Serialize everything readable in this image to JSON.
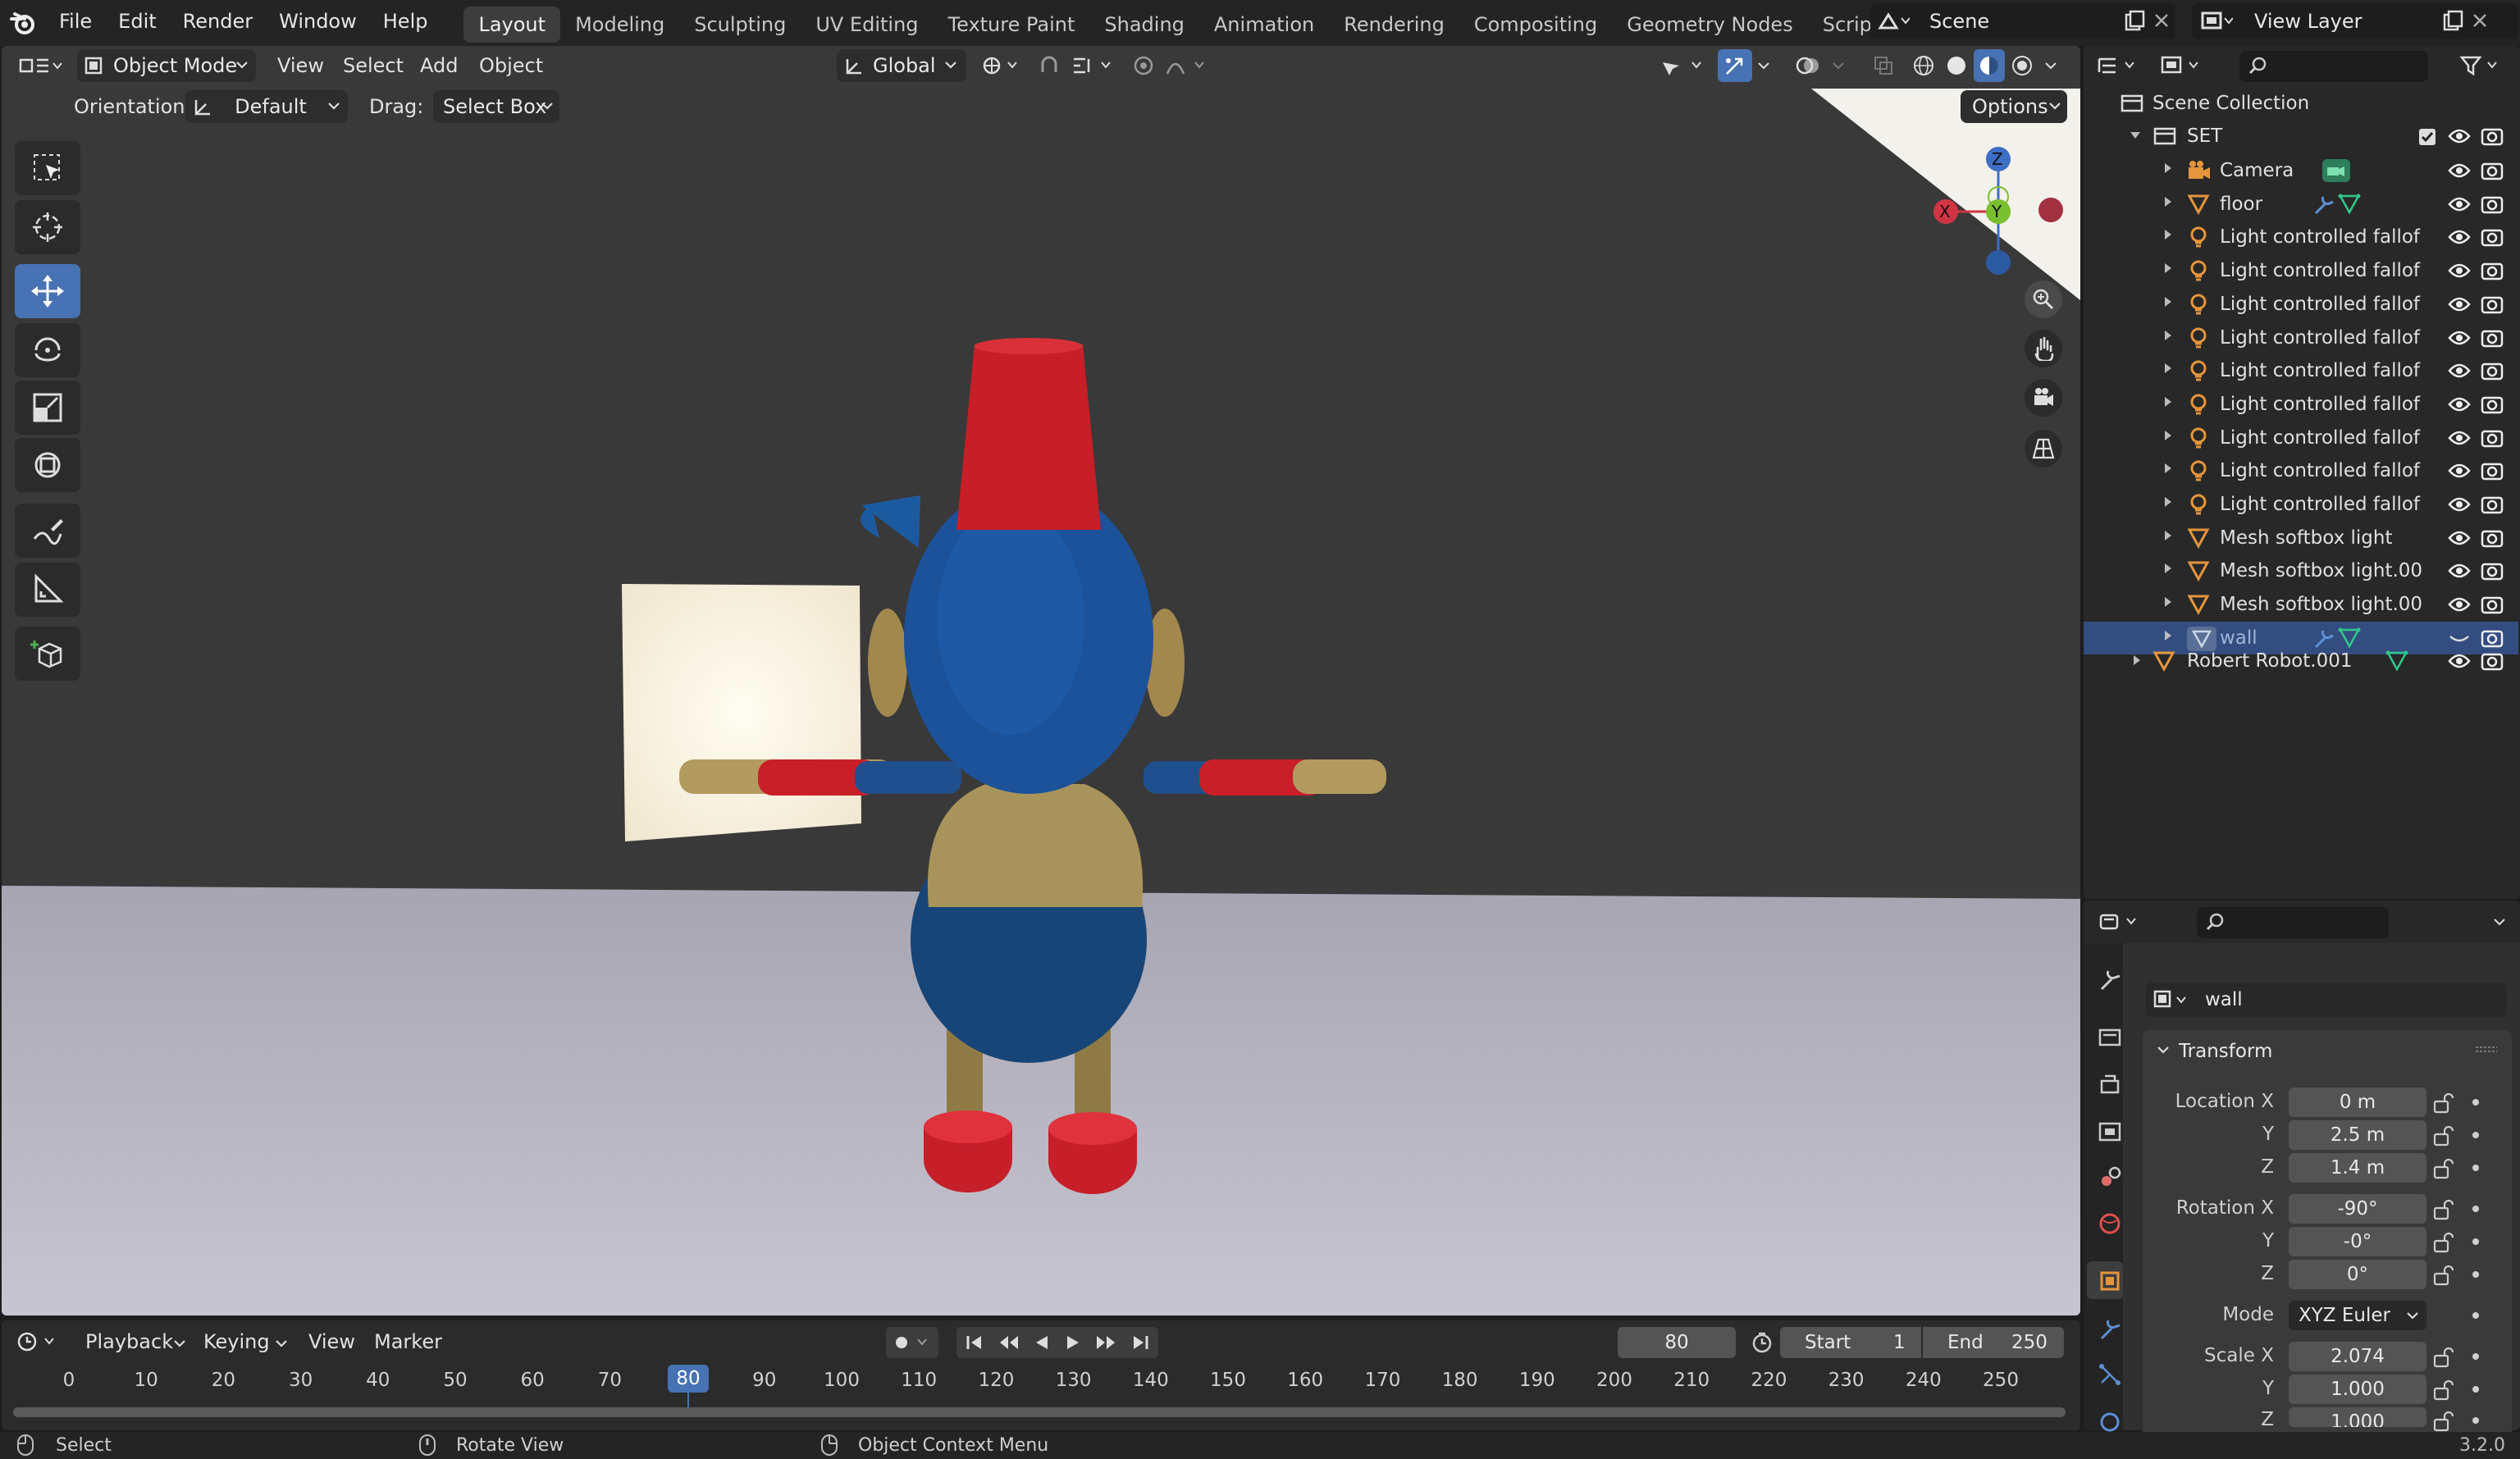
{
  "app": {
    "version": "3.2.0"
  },
  "menu": [
    "File",
    "Edit",
    "Render",
    "Window",
    "Help"
  ],
  "workspaces": [
    "Layout",
    "Modeling",
    "Sculpting",
    "UV Editing",
    "Texture Paint",
    "Shading",
    "Animation",
    "Rendering",
    "Compositing",
    "Geometry Nodes",
    "Scripting"
  ],
  "active_workspace": "Layout",
  "add_workspace": "+",
  "scene": {
    "name": "Scene",
    "view_layer": "View Layer"
  },
  "viewport_header": {
    "mode": "Object Mode",
    "menus": [
      "View",
      "Select",
      "Add",
      "Object"
    ],
    "transform_orientation": "Global",
    "orientation_label": "Orientation:",
    "orientation_value": "Default",
    "drag_label": "Drag:",
    "drag_value": "Select Box",
    "options": "Options"
  },
  "gizmo": {
    "z": "Z",
    "y": "Y",
    "x": "X"
  },
  "tools": [
    "select-box",
    "cursor",
    "move",
    "rotate",
    "scale",
    "transform",
    "annotate",
    "measure",
    "add-cube"
  ],
  "active_tool": "move",
  "outliner": {
    "root": "Scene Collection",
    "collection": "SET",
    "items": [
      {
        "name": "Camera",
        "type": "camera"
      },
      {
        "name": "floor",
        "type": "mesh"
      },
      {
        "name": "Light controlled fallof",
        "type": "light"
      },
      {
        "name": "Light controlled fallof",
        "type": "light"
      },
      {
        "name": "Light controlled fallof",
        "type": "light"
      },
      {
        "name": "Light controlled fallof",
        "type": "light"
      },
      {
        "name": "Light controlled fallof",
        "type": "light"
      },
      {
        "name": "Light controlled fallof",
        "type": "light"
      },
      {
        "name": "Light controlled fallof",
        "type": "light"
      },
      {
        "name": "Light controlled fallof",
        "type": "light"
      },
      {
        "name": "Light controlled fallof",
        "type": "light"
      },
      {
        "name": "Mesh softbox light",
        "type": "mesh"
      },
      {
        "name": "Mesh softbox light.00",
        "type": "mesh"
      },
      {
        "name": "Mesh softbox light.00",
        "type": "mesh"
      },
      {
        "name": "wall",
        "type": "mesh",
        "selected": true
      }
    ],
    "robot": "Robert Robot.001"
  },
  "properties": {
    "object_name": "wall",
    "panel": "Transform",
    "location": {
      "label": "Location X",
      "x": "0 m",
      "y": "2.5 m",
      "z": "1.4 m"
    },
    "rotation": {
      "label": "Rotation X",
      "x": "-90°",
      "y": "-0°",
      "z": "0°"
    },
    "mode_label": "Mode",
    "mode": "XYZ Euler",
    "scale": {
      "label": "Scale X",
      "x": "2.074",
      "y": "1.000",
      "z": "1.000"
    },
    "axis_y": "Y",
    "axis_z": "Z"
  },
  "timeline": {
    "menus": [
      "Playback",
      "Keying",
      "View",
      "Marker"
    ],
    "current_frame": "80",
    "start_label": "Start",
    "start": "1",
    "end_label": "End",
    "end": "250",
    "ticks": [
      "0",
      "10",
      "20",
      "30",
      "40",
      "50",
      "60",
      "70",
      "80",
      "90",
      "100",
      "110",
      "120",
      "130",
      "140",
      "150",
      "160",
      "170",
      "180",
      "190",
      "200",
      "210",
      "220",
      "230",
      "240",
      "250"
    ]
  },
  "statusbar": {
    "select": "Select",
    "rotate": "Rotate View",
    "context": "Object Context Menu"
  },
  "colors": {
    "accent": "#4772b3",
    "header": "#242424",
    "viewport_wall": "#3a3a3a",
    "viewport_floor": "#b8b5c2"
  }
}
